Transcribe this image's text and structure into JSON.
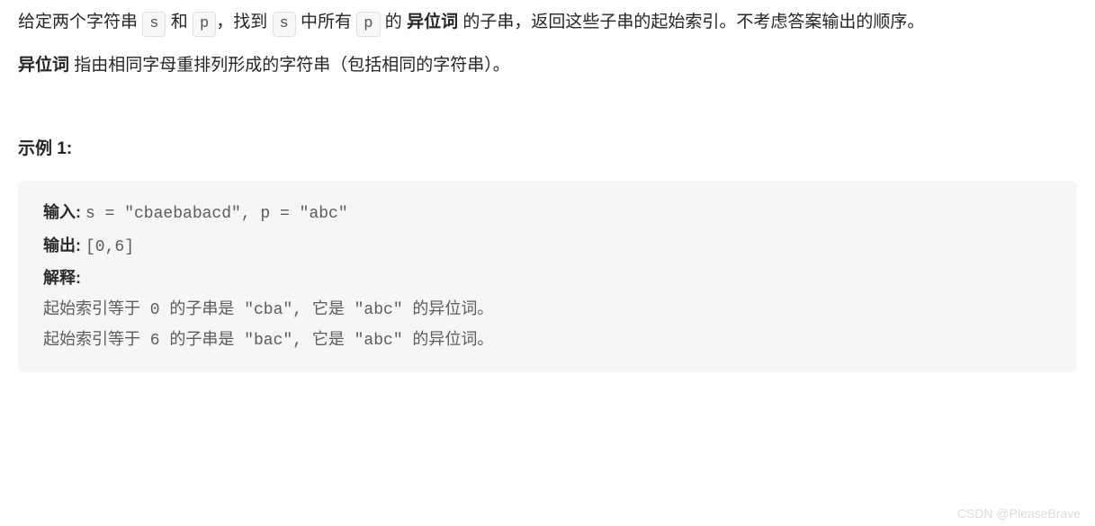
{
  "description": {
    "para1_prefix": "给定两个字符串 ",
    "code_s": "s",
    "para1_mid1": " 和 ",
    "code_p": "p",
    "para1_mid2": "，找到 ",
    "para1_mid3": " 中所有 ",
    "para1_mid4": " 的 ",
    "bold_anagram": "异位词",
    "para1_suffix": " 的子串，返回这些子串的起始索引。不考虑答案输出的顺序。",
    "para2_bold": "异位词 ",
    "para2_rest": "指由相同字母重排列形成的字符串（包括相同的字符串）。"
  },
  "example": {
    "title": "示例 1:",
    "input_label": "输入: ",
    "input_value": "s = \"cbaebabacd\", p = \"abc\"",
    "output_label": "输出: ",
    "output_value": "[0,6]",
    "explain_label": "解释:",
    "explain_line1": "起始索引等于 0 的子串是 \"cba\", 它是 \"abc\" 的异位词。",
    "explain_line2": "起始索引等于 6 的子串是 \"bac\", 它是 \"abc\" 的异位词。"
  },
  "watermark": "CSDN @PleaseBrave"
}
